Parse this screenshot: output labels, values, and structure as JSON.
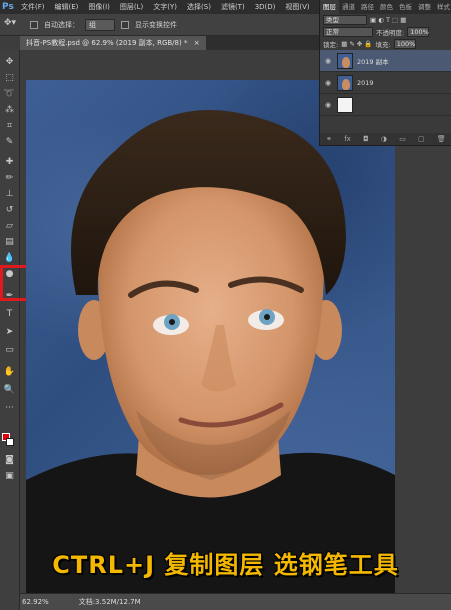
{
  "menubar": {
    "logo": "Ps",
    "items": [
      "文件(F)",
      "编辑(E)",
      "图像(I)",
      "图层(L)",
      "文字(Y)",
      "选择(S)",
      "滤镜(T)",
      "3D(D)",
      "视图(V)"
    ]
  },
  "optbar": {
    "auto_select_label": "自动选择：",
    "auto_select_value": "组",
    "show_transform_label": "显示变换控件"
  },
  "document": {
    "tab_title": "抖音-PS教程.psd @ 62.9% (2019 副本, RGB/8) *",
    "close": "×"
  },
  "layers_panel": {
    "tabs": [
      "图层",
      "通道",
      "路径",
      "颜色",
      "色板",
      "调整",
      "样式"
    ],
    "kind_label": "类型",
    "blend_mode": "正常",
    "opacity_label": "不透明度:",
    "opacity_value": "100%",
    "lock_label": "锁定:",
    "fill_label": "填充:",
    "fill_value": "100%",
    "layers": [
      {
        "name": "2019 副本",
        "selected": true
      },
      {
        "name": "2019",
        "selected": false
      },
      {
        "name": "",
        "selected": false
      }
    ]
  },
  "statusbar": {
    "zoom": "62.92%",
    "doc_info": "文档:3.52M/12.7M"
  },
  "subtitle": "CTRL+J  复制图层  选钢笔工具",
  "colors": {
    "foreground": "#e3000b",
    "background": "#ffffff",
    "subtitle": "#f5b800",
    "highlight": "#e0191c"
  }
}
